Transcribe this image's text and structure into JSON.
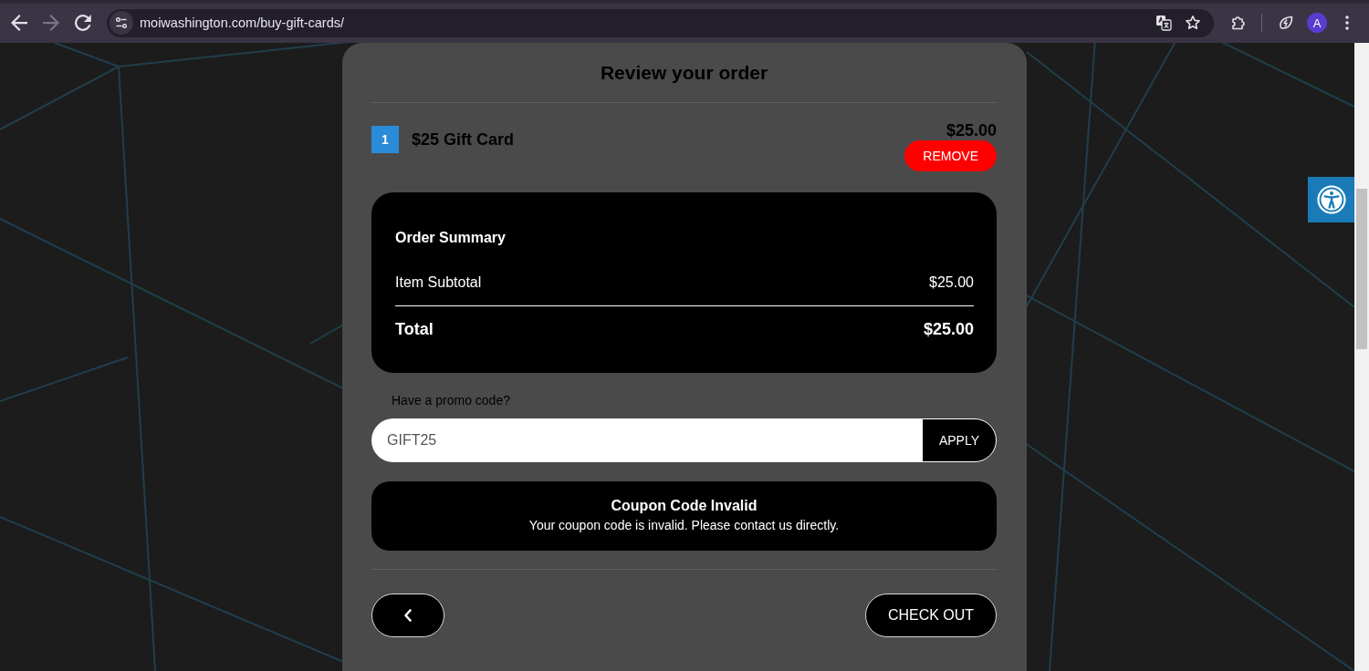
{
  "browser": {
    "url": "moiwashington.com/buy-gift-cards/",
    "forward_disabled": true,
    "profile_initial": "A"
  },
  "order": {
    "title": "Review your order",
    "items": [
      {
        "quantity": "1",
        "name": "$25 Gift Card",
        "price": "$25.00",
        "remove_label": "REMOVE"
      }
    ],
    "summary": {
      "title": "Order Summary",
      "lines": [
        {
          "kind": "subtotal",
          "label": "Item Subtotal",
          "value": "$25.00"
        },
        {
          "kind": "total",
          "label": "Total",
          "value": "$25.00"
        }
      ]
    },
    "promo": {
      "label": "Have a promo code?",
      "value": "GIFT25",
      "apply_label": "APPLY"
    },
    "alert": {
      "title": "Coupon Code Invalid",
      "message": "Your coupon code is invalid. Please contact us directly."
    },
    "checkout_label": "CHECK OUT"
  }
}
